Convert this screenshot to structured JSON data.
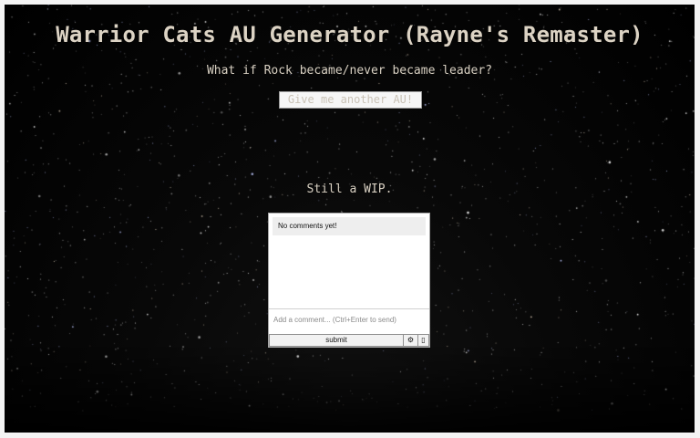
{
  "header": {
    "title": "Warrior Cats AU Generator (Rayne's Remaster)",
    "prompt": "What if Rock became/never became leader?"
  },
  "actions": {
    "generate_label": "Give me another AU!"
  },
  "status": {
    "wip_text": "Still a WIP."
  },
  "comments": {
    "empty_text": "No comments yet!",
    "input_value": "",
    "input_placeholder": "Add a comment... (Ctrl+Enter to send)",
    "submit_label": "submit",
    "settings_icon": "gear-icon",
    "settings_glyph": "⚙",
    "more_icon": "info-icon",
    "more_glyph": "▯"
  },
  "colors": {
    "text": "#dcd3c4",
    "background": "#000000",
    "button_bg": "#f6f6f6",
    "button_text": "#c9c2b6"
  },
  "background": {
    "description_icon": "starfield-background"
  }
}
